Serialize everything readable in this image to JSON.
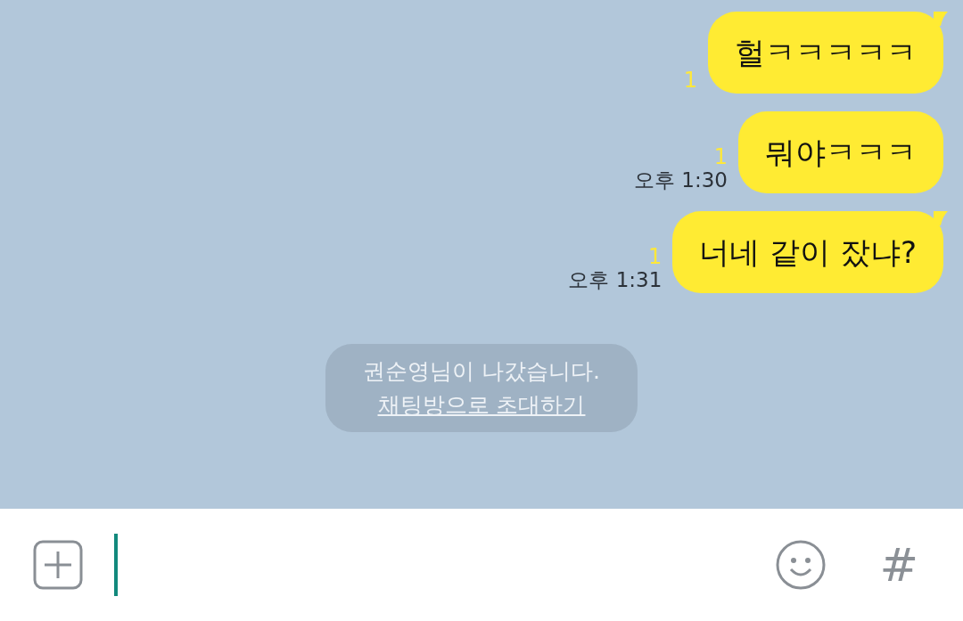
{
  "messages": [
    {
      "text": "헐ㅋㅋㅋㅋㅋ",
      "unread": "1",
      "tail": true
    },
    {
      "text": "뭐야ㅋㅋㅋ",
      "unread": "1",
      "time": "오후 1:30",
      "tail": false
    },
    {
      "text": "너네 같이 잤냐?",
      "unread": "1",
      "time": "오후 1:31",
      "tail": true
    }
  ],
  "notice": {
    "text": "권순영님이 나갔습니다.",
    "link": "채팅방으로 초대하기"
  },
  "composer": {
    "focused": true,
    "hash_button": "#"
  }
}
